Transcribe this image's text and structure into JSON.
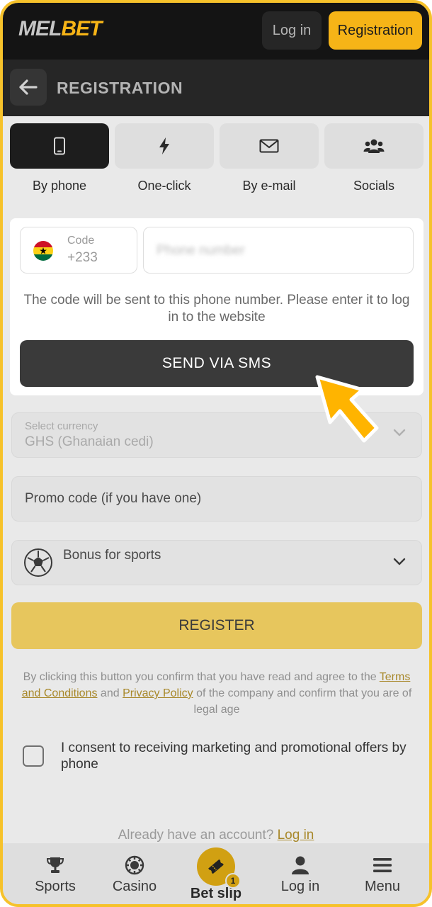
{
  "topbar": {
    "logo_mel": "MEL",
    "logo_bet": "BET",
    "login_label": "Log in",
    "registration_label": "Registration"
  },
  "header": {
    "title": "REGISTRATION",
    "back_icon": "arrow-left-icon"
  },
  "tabs": [
    {
      "label": "By phone",
      "icon": "smartphone-icon",
      "active": true
    },
    {
      "label": "One-click",
      "icon": "lightning-icon",
      "active": false
    },
    {
      "label": "By e-mail",
      "icon": "envelope-icon",
      "active": false
    },
    {
      "label": "Socials",
      "icon": "users-icon",
      "active": false
    }
  ],
  "phone_form": {
    "code_label": "Code",
    "code_value": "+233",
    "country_flag": "ghana-flag-icon",
    "phone_placeholder": "Phone number",
    "hint": "The code will be sent to this phone number. Please enter it to log in to the website",
    "send_label": "SEND VIA SMS"
  },
  "currency": {
    "label": "Select currency",
    "value": "GHS  (Ghanaian cedi)"
  },
  "promo": {
    "placeholder": "Promo code (if you have one)"
  },
  "bonus": {
    "label": "Bonus for sports",
    "icon": "soccer-ball-icon"
  },
  "register_label": "REGISTER",
  "terms": {
    "prefix": "By clicking this button you confirm that you have read and agree to the ",
    "terms_link": "Terms and Conditions",
    "and": " and ",
    "privacy_link": "Privacy Policy",
    "suffix": " of the company and confirm that you are of legal age"
  },
  "consent": "I consent to receiving marketing and promotional offers by phone",
  "already": {
    "text": "Already have an account? ",
    "link": "Log in"
  },
  "bottom_nav": [
    {
      "label": "Sports",
      "icon": "trophy-icon"
    },
    {
      "label": "Casino",
      "icon": "casino-chip-icon"
    },
    {
      "label": "Bet slip",
      "icon": "ticket-icon",
      "badge": "1"
    },
    {
      "label": "Log in",
      "icon": "user-icon"
    },
    {
      "label": "Menu",
      "icon": "hamburger-menu-icon"
    }
  ],
  "colors": {
    "accent": "#f6b417",
    "dark": "#141414",
    "pointer": "#ffb400"
  }
}
